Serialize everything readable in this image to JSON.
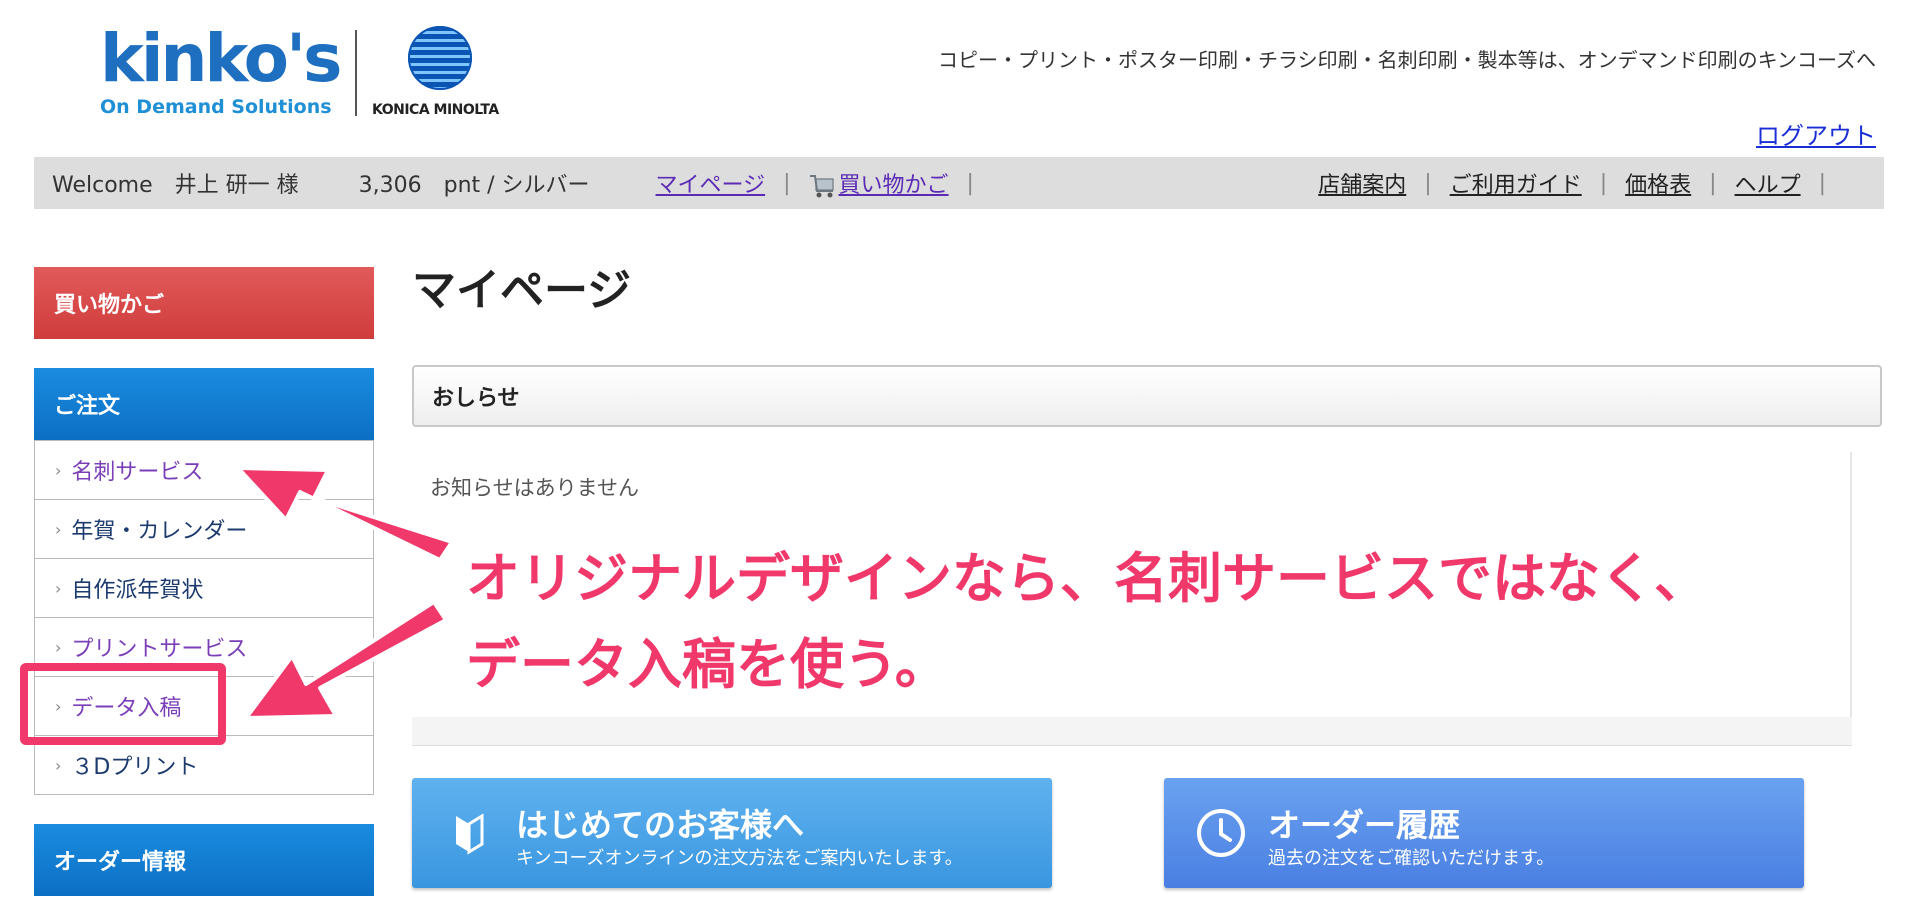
{
  "header": {
    "logo_text": "kinko's",
    "logo_sub": "On Demand Solutions",
    "partner_logo_text": "KONICA MINOLTA",
    "tagline": "コピー・プリント・ポスター印刷・チラシ印刷・名刺印刷・製本等は、オンデマンド印刷のキンコーズへ",
    "logout": "ログアウト"
  },
  "topbar": {
    "welcome": "Welcome　井上 研一 様",
    "points": "3,306　pnt / シルバー",
    "mypage": "マイページ",
    "cart": "買い物かご",
    "store_info": "店舗案内",
    "guide": "ご利用ガイド",
    "price_list": "価格表",
    "help": "ヘルプ",
    "separator": "|"
  },
  "sidebar": {
    "cart_header": "買い物かご",
    "order_header": "ご注文",
    "order_items": [
      {
        "label": "名刺サービス"
      },
      {
        "label": "年賀・カレンダー"
      },
      {
        "label": "自作派年賀状"
      },
      {
        "label": "プリントサービス"
      },
      {
        "label": "データ入稿"
      },
      {
        "label": "３Dプリント"
      }
    ],
    "order_info_header": "オーダー情報"
  },
  "main": {
    "title": "マイページ",
    "notice_header": "おしらせ",
    "notice_empty": "お知らせはありません",
    "buttons": [
      {
        "title": "はじめてのお客様へ",
        "subtitle": "キンコーズオンラインの注文方法をご案内いたします。",
        "icon": "beginner-mark-icon"
      },
      {
        "title": "オーダー履歴",
        "subtitle": "過去の注文をご確認いただけます。",
        "icon": "clock-icon"
      }
    ]
  },
  "annotation": {
    "line1": "オリジナルデザインなら、名刺サービスではなく、",
    "line2": "データ入稿を使う。",
    "color": "#f0386b"
  },
  "colors": {
    "brand_blue": "#1f6fc0",
    "sidebar_red": "#cf3c3c",
    "sidebar_blue": "#0c6fc4",
    "link_purple": "#5b2bb5",
    "logout_blue": "#1a2ed6"
  }
}
